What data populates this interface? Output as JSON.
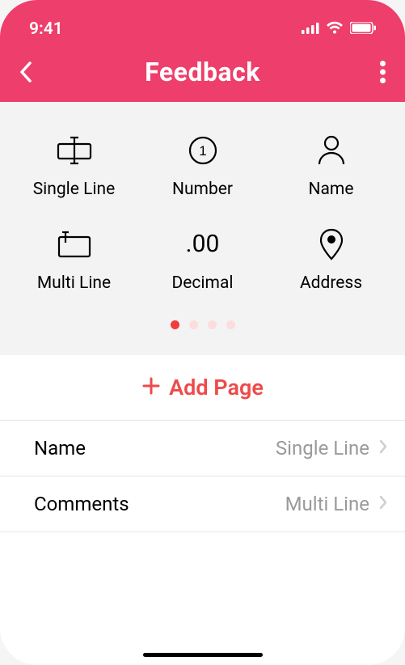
{
  "status": {
    "time": "9:41"
  },
  "nav": {
    "title": "Feedback"
  },
  "palette": {
    "items": [
      {
        "label": "Single Line"
      },
      {
        "label": "Number"
      },
      {
        "label": "Name"
      },
      {
        "label": "Multi Line"
      },
      {
        "label": "Decimal",
        "glyph": ".00"
      },
      {
        "label": "Address"
      }
    ],
    "page_count": 4,
    "active_page": 0
  },
  "add_page": {
    "label": "Add Page"
  },
  "fields": [
    {
      "name": "Name",
      "type": "Single Line"
    },
    {
      "name": "Comments",
      "type": "Multi Line"
    }
  ]
}
